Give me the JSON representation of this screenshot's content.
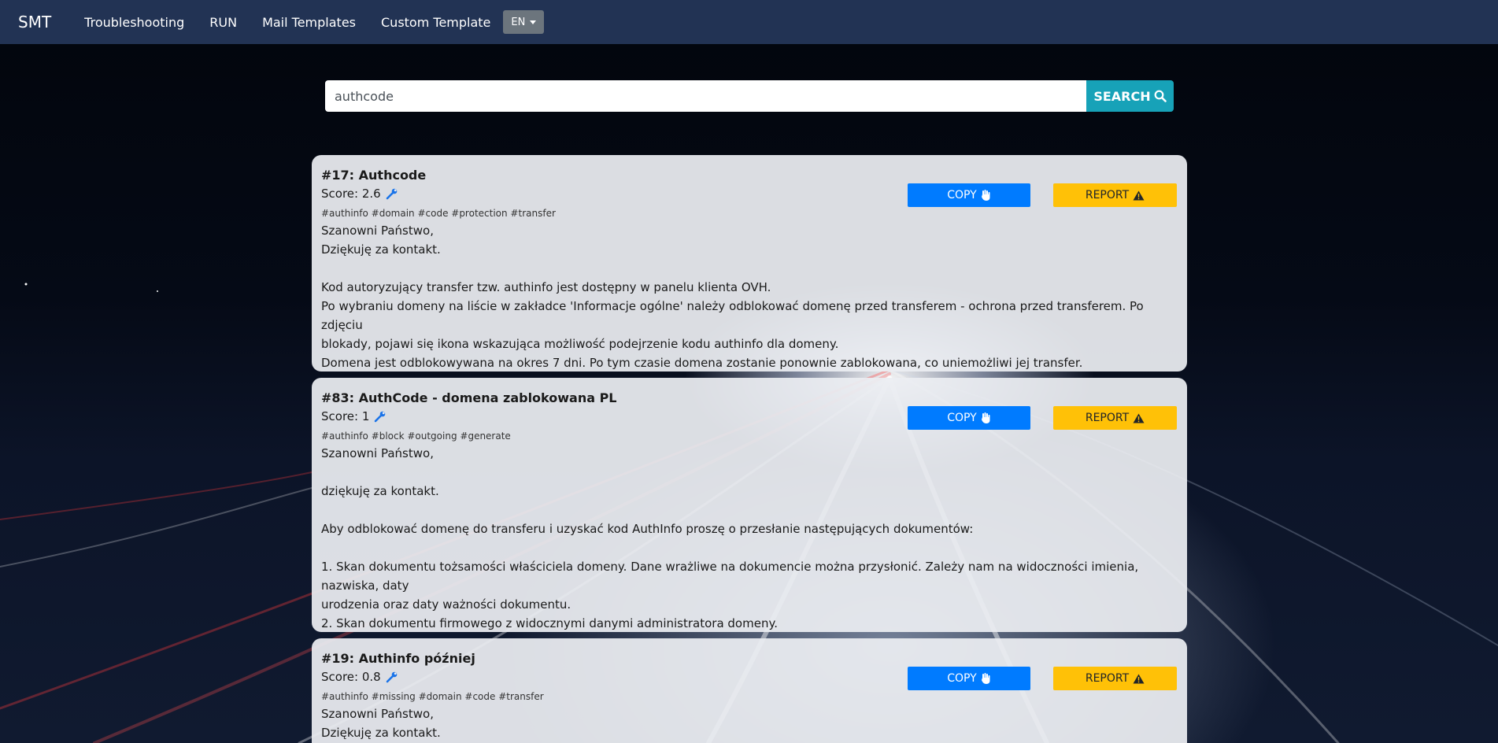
{
  "navbar": {
    "brand": "SMT",
    "links": [
      "Troubleshooting",
      "RUN",
      "Mail Templates",
      "Custom Template"
    ],
    "lang": "EN"
  },
  "search": {
    "value": "authcode",
    "button_label": "SEARCH"
  },
  "buttons": {
    "copy": "COPY",
    "report": "REPORT"
  },
  "colors": {
    "navbar": "#223354",
    "search": "#17a2b8",
    "copy": "#007bff",
    "report": "#ffc107",
    "wrench": "#1a73e8"
  },
  "results": [
    {
      "title": "#17: Authcode",
      "score": "Score: 2.6",
      "tags": "#authinfo #domain #code #protection #transfer",
      "lines": [
        "Szanowni Państwo,",
        "Dziękuję za kontakt.",
        "",
        "Kod autoryzujący transfer tzw. authinfo jest dostępny w panelu klienta OVH.",
        "Po wybraniu domeny na liście w zakładce 'Informacje ogólne' należy odblokować domenę przed transferem - ochrona przed transferem. Po zdjęciu",
        "blokady, pojawi się ikona wskazująca możliwość podejrzenie kodu authinfo dla domeny.",
        "Domena jest odblokowywana na okres 7 dni. Po tym czasie domena zostanie ponownie zablokowana, co uniemożliwi jej transfer."
      ]
    },
    {
      "title": "#83: AuthCode - domena zablokowana PL",
      "score": "Score: 1",
      "tags": "#authinfo #block #outgoing #generate",
      "lines": [
        "Szanowni Państwo,",
        "",
        "dziękuję za kontakt.",
        "",
        "Aby odblokować domenę do transferu i uzyskać kod AuthInfo proszę o przesłanie następujących dokumentów:",
        "",
        "1. Skan dokumentu tożsamości właściciela domeny.  Dane wrażliwe na dokumencie można przysłonić. Zależy nam na widoczności  imienia, nazwiska, daty",
        "urodzenia oraz daty ważności dokumentu.",
        "2. Skan dokumentu firmowego z widocznymi danymi administratora domeny."
      ]
    },
    {
      "title": "#19: Authinfo później",
      "score": "Score: 0.8",
      "tags": "#authinfo #missing #domain #code #transfer",
      "lines": [
        "Szanowni Państwo,",
        "Dziękuję za kontakt."
      ]
    }
  ]
}
